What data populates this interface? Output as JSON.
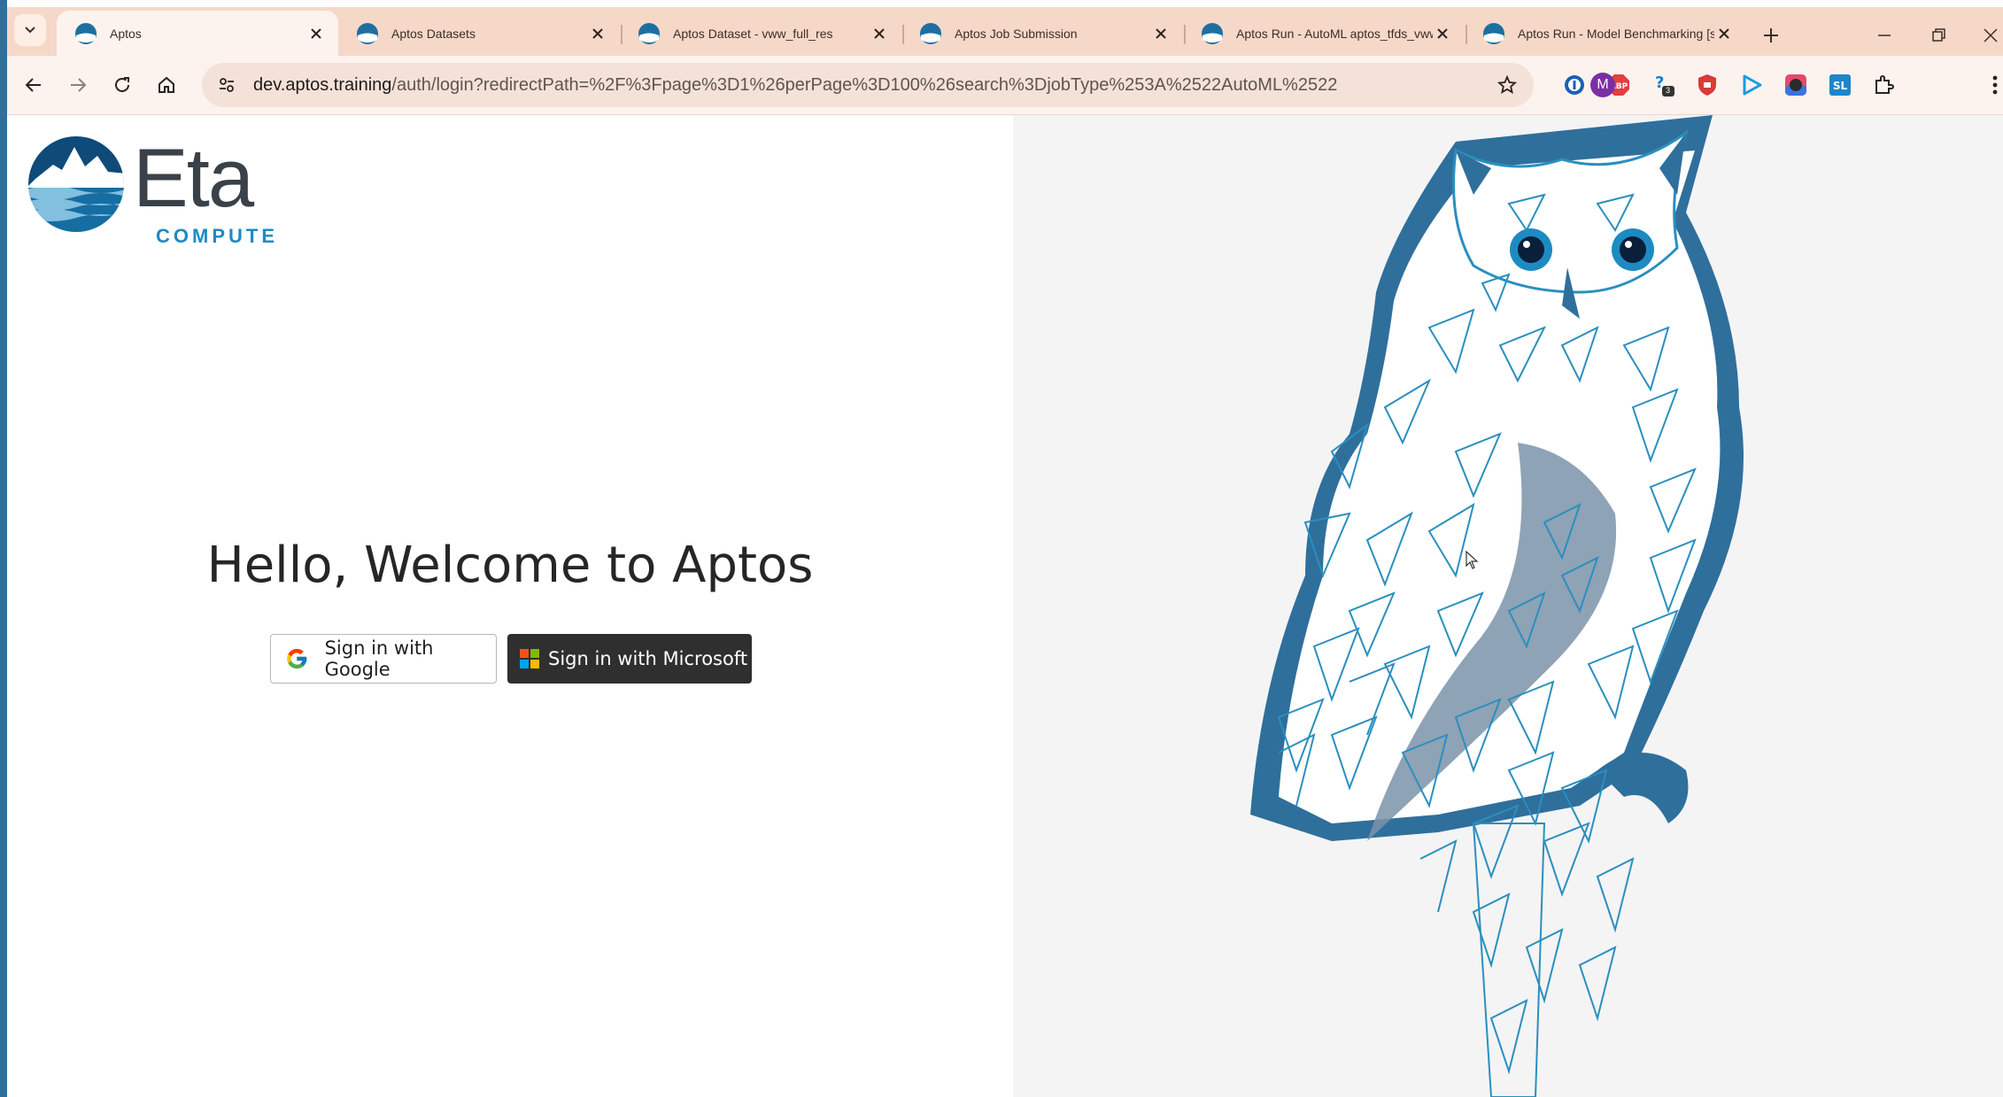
{
  "browser": {
    "tabs": [
      {
        "title": "Aptos",
        "active": true
      },
      {
        "title": "Aptos Datasets",
        "active": false
      },
      {
        "title": "Aptos Dataset - vww_full_res",
        "active": false
      },
      {
        "title": "Aptos Job Submission",
        "active": false
      },
      {
        "title": "Aptos Run - AutoML aptos_tfds_vww on SIL",
        "active": false
      },
      {
        "title": "Aptos Run - Model Benchmarking [staging]",
        "active": false
      }
    ],
    "url_host": "dev.aptos.training",
    "url_path": "/auth/login?redirectPath=%2F%3Fpage%3D1%26perPage%3D100%26search%3DjobType%253A%2522AutoML%2522",
    "profile_initial": "M",
    "extension_badge": "3"
  },
  "brand": {
    "wordmark": "Eta",
    "subtitle": "COMPUTE"
  },
  "login": {
    "heading": "Hello, Welcome to Aptos",
    "google_label": "Sign in with Google",
    "microsoft_label": "Sign in with Microsoft"
  },
  "colors": {
    "tabstrip": "#f6d8c8",
    "brand_blue": "#1d8bc2",
    "owl_line": "#2a8fbf",
    "owl_shadow": "#2f6f9c"
  }
}
